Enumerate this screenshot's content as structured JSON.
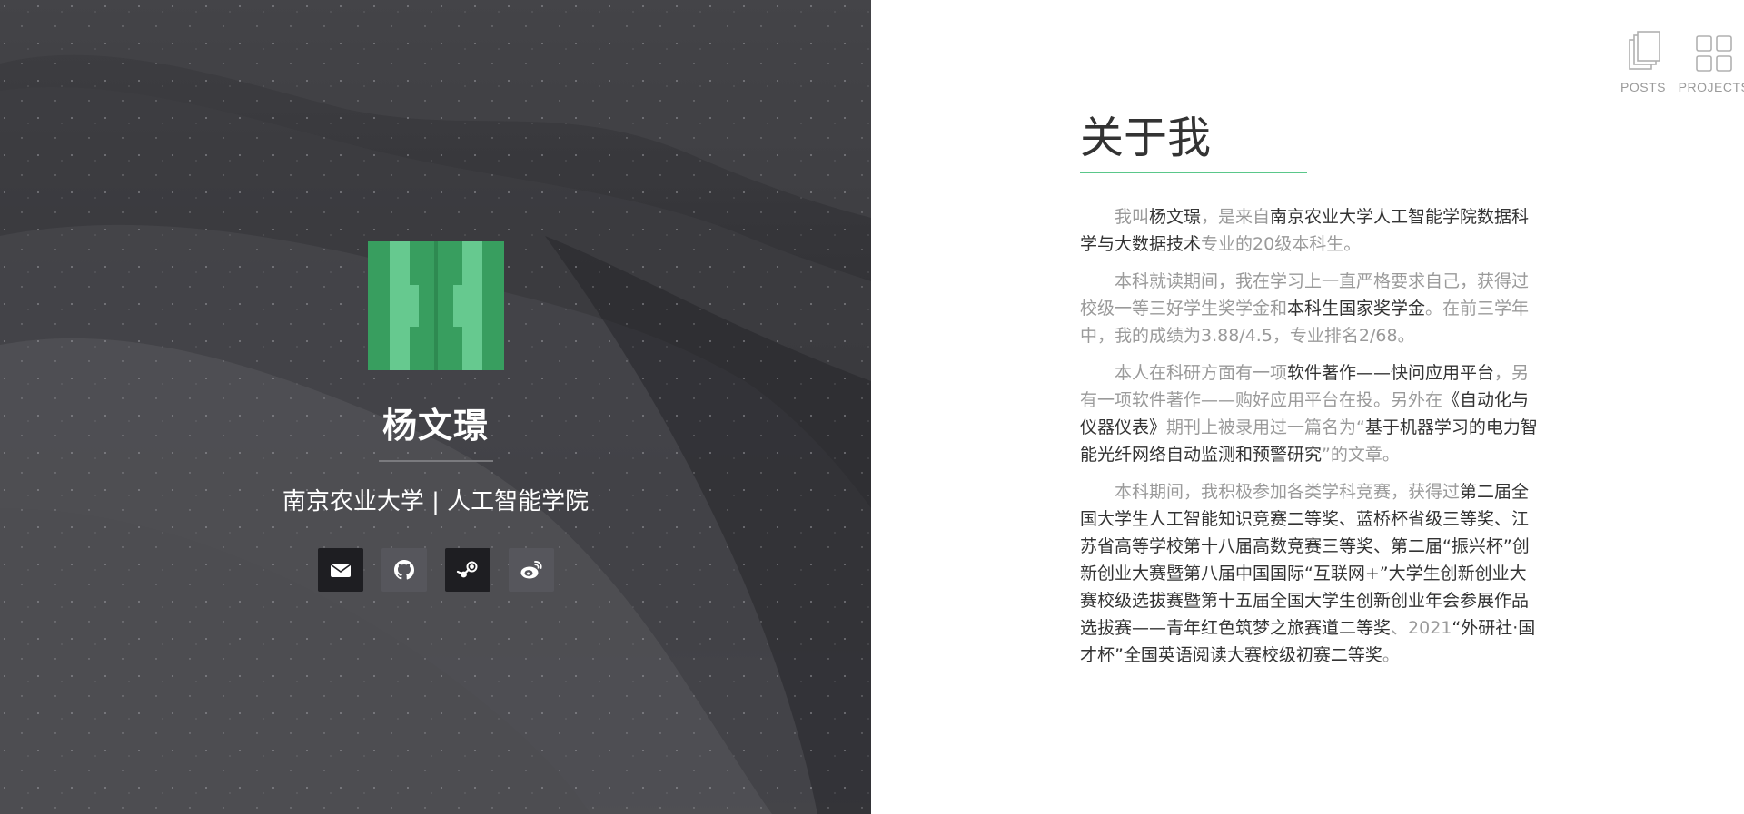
{
  "profile": {
    "name": "杨文璟",
    "subtitle": "南京农业大学 | 人工智能学院",
    "socials": [
      {
        "icon": "envelope-icon",
        "label": "email"
      },
      {
        "icon": "github-icon",
        "label": "github"
      },
      {
        "icon": "steam-icon",
        "label": "steam"
      },
      {
        "icon": "weibo-icon",
        "label": "weibo"
      }
    ],
    "logo_colors": {
      "dark": "#389e5f",
      "light": "#66c98f"
    }
  },
  "nav": {
    "posts_label": "POSTS",
    "projects_label": "PROJECTS"
  },
  "about": {
    "title": "关于我",
    "accent_color": "#5ac78a",
    "paragraphs": [
      [
        {
          "t": "我叫",
          "h": false
        },
        {
          "t": "杨文璟",
          "h": true
        },
        {
          "t": "，是来自",
          "h": false
        },
        {
          "t": "南京农业大学人工智能学院数据科学与大数据技术",
          "h": true
        },
        {
          "t": "专业的20级本科生。",
          "h": false
        }
      ],
      [
        {
          "t": "本科就读期间，我在学习上一直严格要求自己，获得过校级一等三好学生奖学金和",
          "h": false
        },
        {
          "t": "本科生国家奖学金",
          "h": true
        },
        {
          "t": "。在前三学年中，我的成绩为3.88/4.5，专业排名2/68。",
          "h": false
        }
      ],
      [
        {
          "t": "本人在科研方面有一项",
          "h": false
        },
        {
          "t": "软件著作——快问应用平台",
          "h": true
        },
        {
          "t": "，另有一项软件著作——购好应用平台在投。另外在",
          "h": false
        },
        {
          "t": "《自动化与仪器仪表》",
          "h": true
        },
        {
          "t": "期刊上被录用过一篇名为“",
          "h": false
        },
        {
          "t": "基于机器学习的电力智能光纤网络自动监测和预警研究",
          "h": true
        },
        {
          "t": "”的文章。",
          "h": false
        }
      ],
      [
        {
          "t": "本科期间，我积极参加各类学科竞赛，获得过",
          "h": false
        },
        {
          "t": "第二届全国大学生人工智能知识竞赛二等奖、蓝桥杯省级三等奖、江苏省高等学校第十八届高数竞赛三等奖、第二届“振兴杯”创新创业大赛暨第八届中国国际“互联网+”大学生创新创业大赛校级选拔赛暨第十五届全国大学生创新创业年会参展作品选拔赛——青年红色筑梦之旅赛道二等奖",
          "h": true
        },
        {
          "t": "、2021",
          "h": false
        },
        {
          "t": "“外研社·国才杯”全国英语阅读大赛校级初赛二等奖",
          "h": true
        },
        {
          "t": "。",
          "h": false
        }
      ]
    ]
  }
}
